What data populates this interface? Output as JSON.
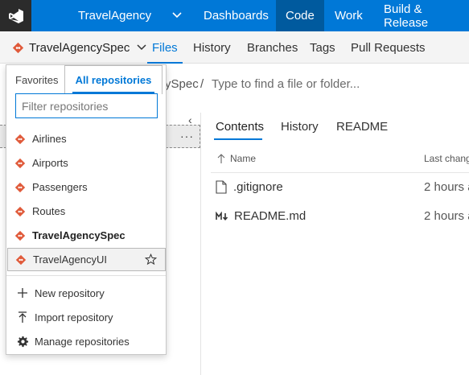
{
  "header": {
    "project": "TravelAgency",
    "nav": [
      "Dashboards",
      "Code",
      "Work",
      "Build & Release"
    ]
  },
  "subnav": {
    "repo": "TravelAgencySpec",
    "tabs": [
      "Files",
      "History",
      "Branches",
      "Tags",
      "Pull Requests"
    ]
  },
  "path": {
    "crumb_tail": "ySpec",
    "separator": "/",
    "placeholder": "Type to find a file or folder..."
  },
  "content_tabs": [
    "Contents",
    "History",
    "README"
  ],
  "table": {
    "headers": [
      "Name",
      "Last chang"
    ],
    "rows": [
      {
        "name": ".gitignore",
        "date": "2 hours a",
        "icon": "file-icon"
      },
      {
        "name": "README.md",
        "date": "2 hours a",
        "icon": "markdown-icon"
      }
    ]
  },
  "tree": {
    "more": "···"
  },
  "dropdown": {
    "tabs": [
      "Favorites",
      "All repositories"
    ],
    "filter_placeholder": "Filter repositories",
    "repos": [
      "Airlines",
      "Airports",
      "Passengers",
      "Routes",
      "TravelAgencySpec",
      "TravelAgencyUI"
    ],
    "actions": [
      {
        "label": "New repository",
        "icon": "plus-icon"
      },
      {
        "label": "Import repository",
        "icon": "import-icon"
      },
      {
        "label": "Manage repositories",
        "icon": "gear-icon"
      }
    ]
  },
  "colors": {
    "accent": "#0078d7",
    "header_bg": "#0078d7",
    "logo_bg": "#2b2b2b",
    "git_icon": "#e05a3a"
  }
}
